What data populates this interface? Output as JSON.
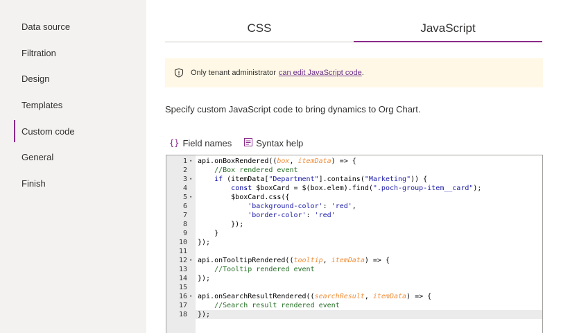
{
  "sidebar": {
    "items": [
      {
        "label": "Data source",
        "active": false
      },
      {
        "label": "Filtration",
        "active": false
      },
      {
        "label": "Design",
        "active": false
      },
      {
        "label": "Templates",
        "active": false
      },
      {
        "label": "Custom code",
        "active": true
      },
      {
        "label": "General",
        "active": false
      },
      {
        "label": "Finish",
        "active": false
      }
    ]
  },
  "tabs": [
    {
      "label": "CSS",
      "active": false
    },
    {
      "label": "JavaScript",
      "active": true
    }
  ],
  "banner": {
    "icon": "shield-icon",
    "text": "Only tenant administrator",
    "link": "can edit JavaScript code",
    "suffix": "."
  },
  "description": "Specify custom JavaScript code to bring dynamics to Org Chart.",
  "toolbar": {
    "field_names": "Field names",
    "syntax_help": "Syntax help"
  },
  "colors": {
    "accent": "#8a2a8a",
    "banner_bg": "#fff8e6",
    "sidebar_bg": "#f3f2f1"
  },
  "editor": {
    "current_line": 18,
    "lines": [
      {
        "n": "1",
        "fold": true,
        "html": "api.onBoxRendered((<span class=\"par\">box</span>, <span class=\"par\">itemData</span>) =&gt; {"
      },
      {
        "n": "2",
        "fold": false,
        "html": "    <span class=\"cm\">//Box rendered event</span>"
      },
      {
        "n": "3",
        "fold": true,
        "html": "    <span class=\"kw\">if</span> (itemData[<span class=\"str\">\"Department\"</span>].contains(<span class=\"str\">\"Marketing\"</span>)) {"
      },
      {
        "n": "4",
        "fold": false,
        "html": "        <span class=\"kw\">const</span> $boxCard = $(box.elem).find(<span class=\"str\">\".poch-group-item__card\"</span>);"
      },
      {
        "n": "5",
        "fold": true,
        "html": "        $boxCard.css({"
      },
      {
        "n": "6",
        "fold": false,
        "html": "            <span class=\"str\">'background-color'</span>: <span class=\"str\">'red'</span>,"
      },
      {
        "n": "7",
        "fold": false,
        "html": "            <span class=\"str\">'border-color'</span>: <span class=\"str\">'red'</span>"
      },
      {
        "n": "8",
        "fold": false,
        "html": "        });"
      },
      {
        "n": "9",
        "fold": false,
        "html": "    }"
      },
      {
        "n": "10",
        "fold": false,
        "html": "});"
      },
      {
        "n": "11",
        "fold": false,
        "html": ""
      },
      {
        "n": "12",
        "fold": true,
        "html": "api.onTooltipRendered((<span class=\"par\">tooltip</span>, <span class=\"par\">itemData</span>) =&gt; {"
      },
      {
        "n": "13",
        "fold": false,
        "html": "    <span class=\"cm\">//Tooltip rendered event</span>"
      },
      {
        "n": "14",
        "fold": false,
        "html": "});"
      },
      {
        "n": "15",
        "fold": false,
        "html": ""
      },
      {
        "n": "16",
        "fold": true,
        "html": "api.onSearchResultRendered((<span class=\"par\">searchResult</span>, <span class=\"par\">itemData</span>) =&gt; {"
      },
      {
        "n": "17",
        "fold": false,
        "html": "    <span class=\"cm\">//Search result rendered event</span>"
      },
      {
        "n": "18",
        "fold": false,
        "html": "});"
      }
    ]
  }
}
